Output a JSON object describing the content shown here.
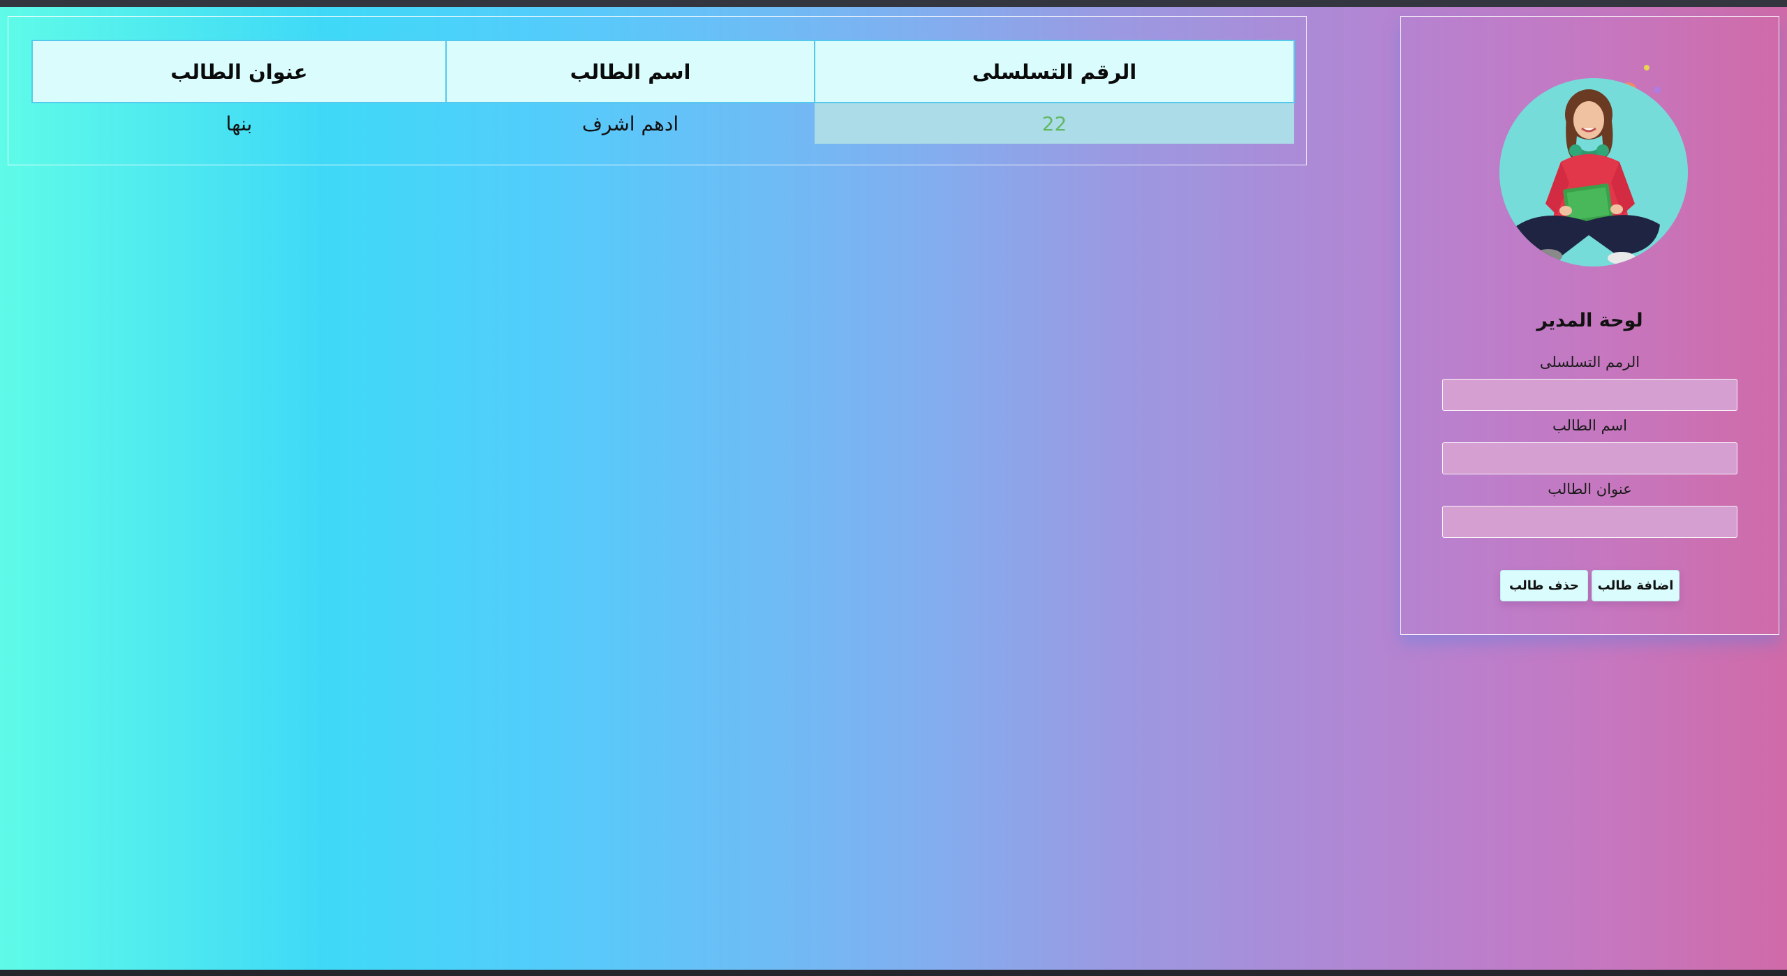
{
  "table": {
    "headers": [
      "الرقم التسلسلى",
      "اسم الطالب",
      "عنوان الطالب"
    ],
    "rows": [
      {
        "serial": "22",
        "name": "ادهم اشرف",
        "address": "بنها"
      }
    ]
  },
  "admin_panel": {
    "title": "لوحة المدير",
    "fields": {
      "serial_label": "الرمم التسلسلى",
      "serial_value": "",
      "name_label": "اسم الطالب",
      "name_value": "",
      "address_label": "عنوان الطالب",
      "address_value": ""
    },
    "buttons": {
      "add": "اضافة طالب",
      "delete": "حذف طالب"
    }
  },
  "colors": {
    "header_bg": "#dafcfc",
    "serial_cell_bg": "#acdce8",
    "serial_text": "#62b865",
    "input_bg": "#d59fd1",
    "button_bg": "#dafcfc"
  }
}
